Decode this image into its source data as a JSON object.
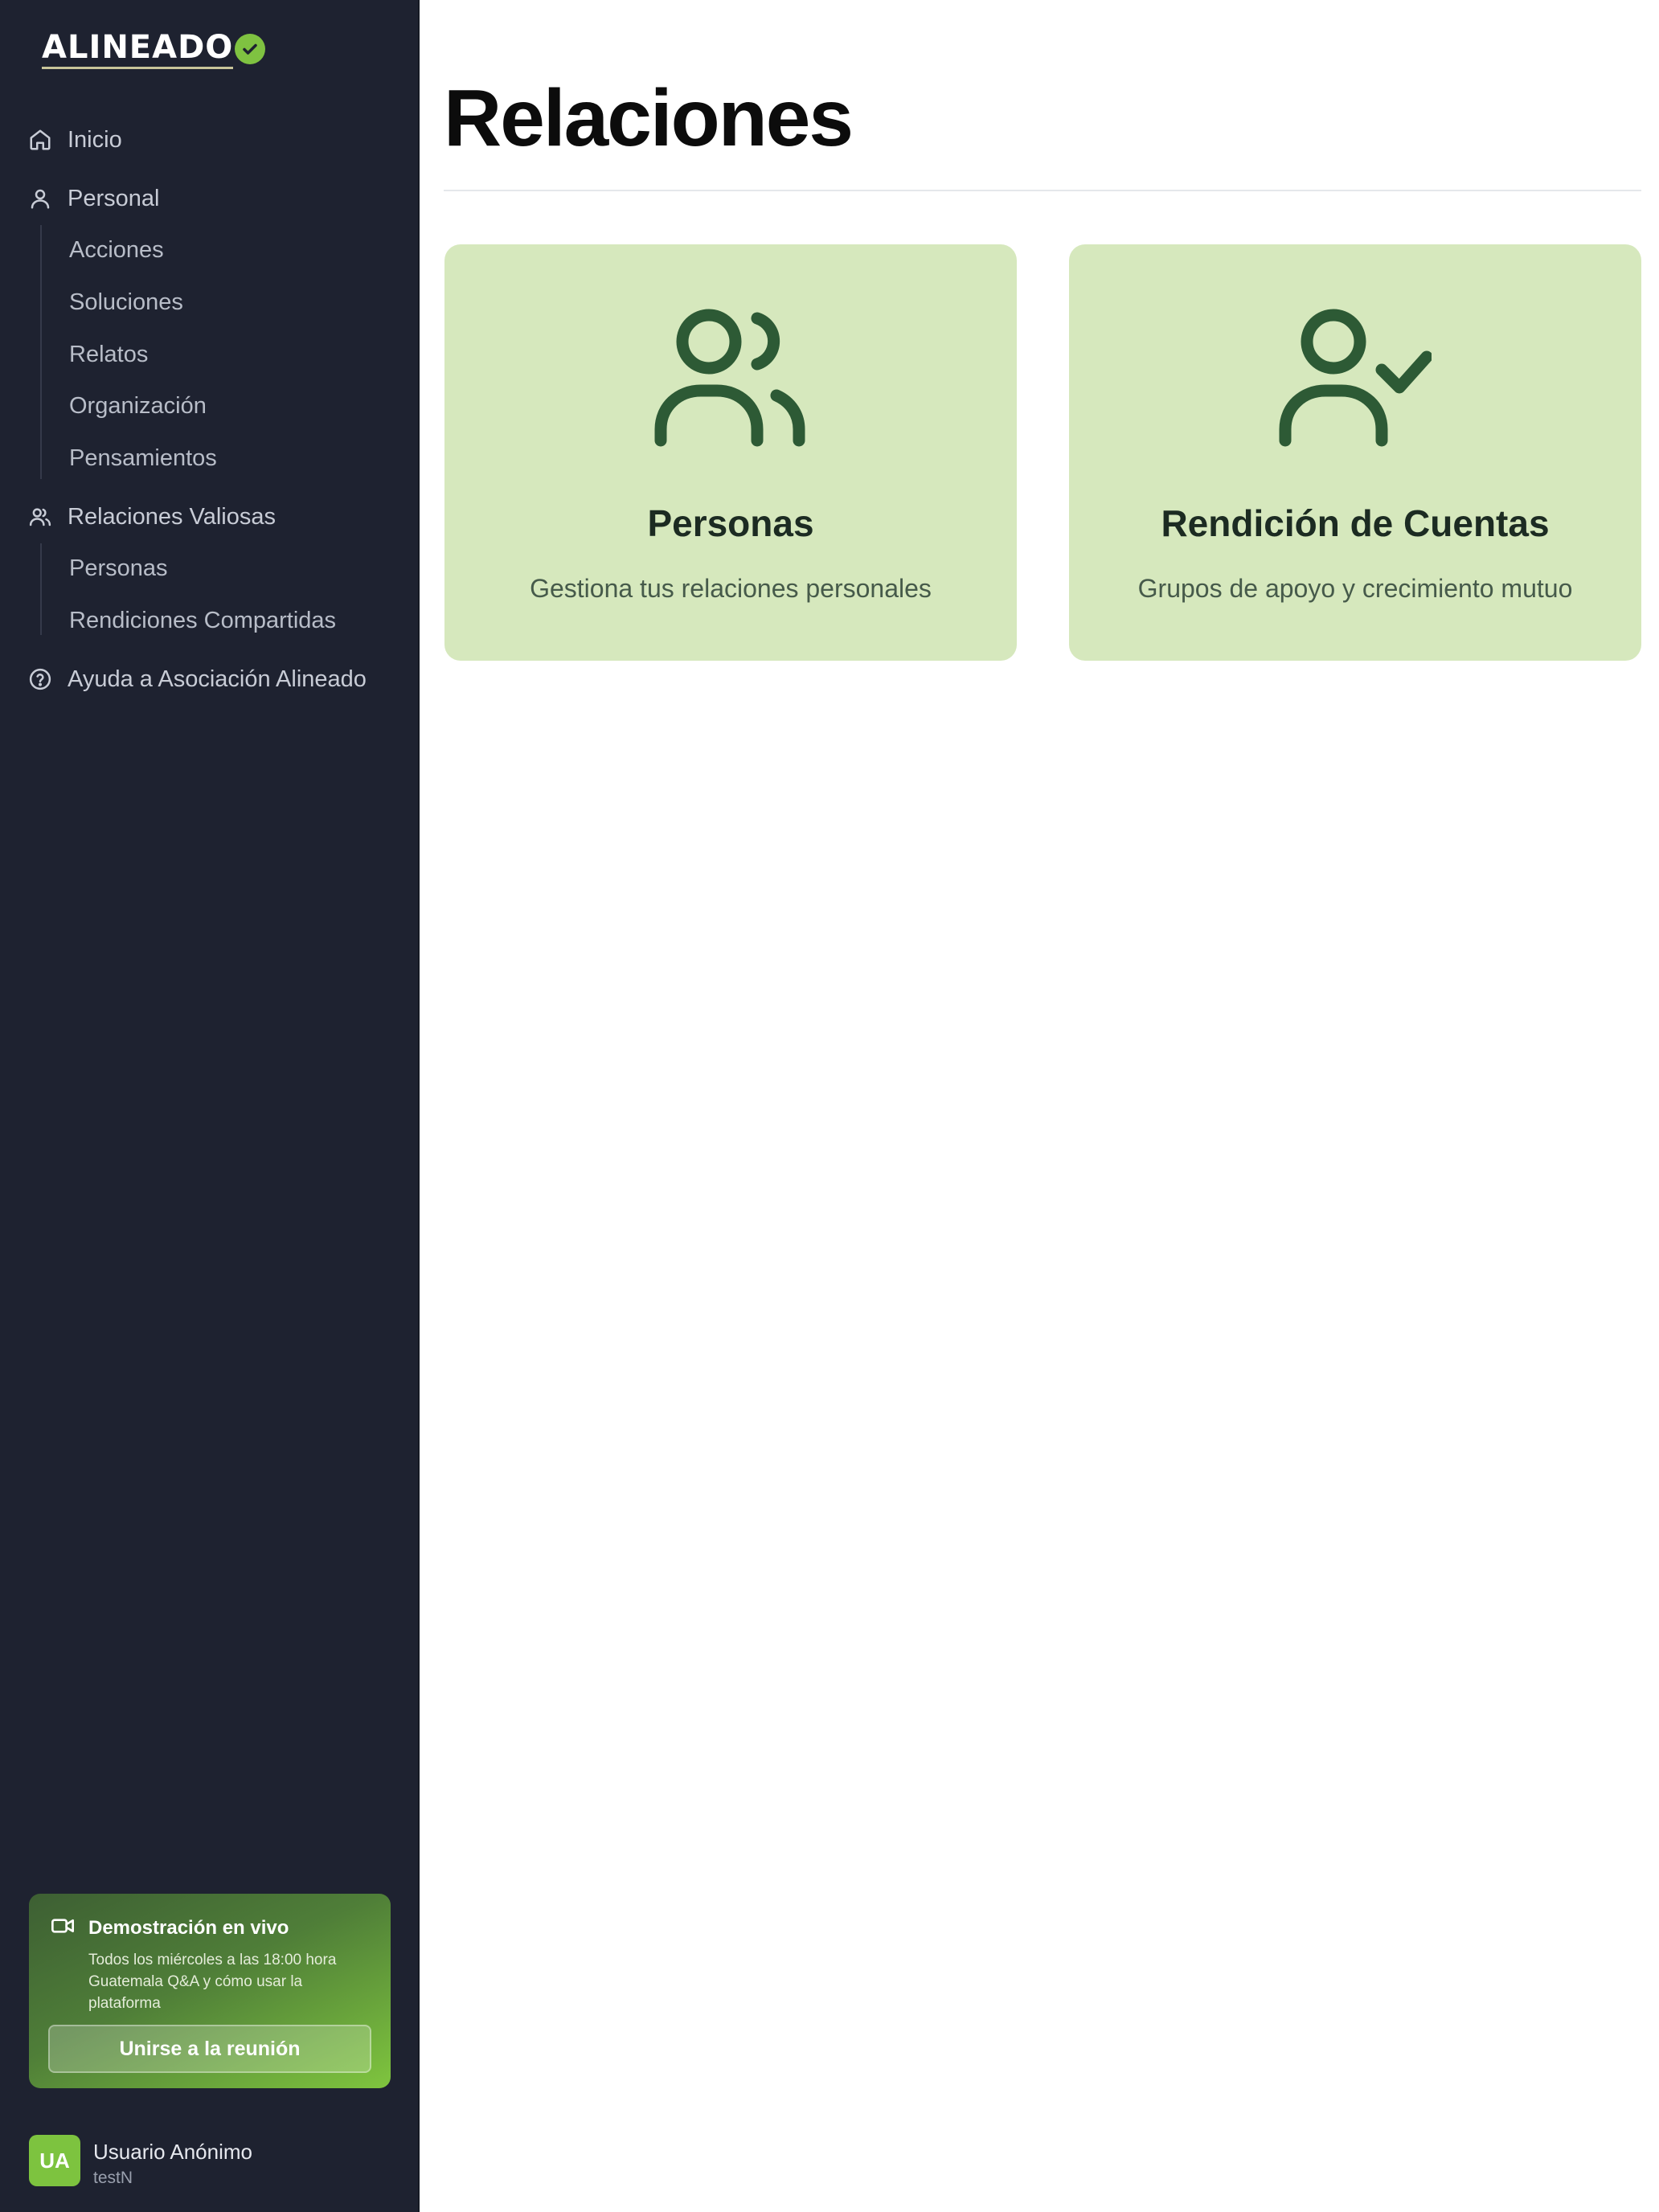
{
  "brand": {
    "logo_text": "ALINEADO",
    "logo_icon": "check-circle-icon",
    "accent": "#7fc241"
  },
  "sidebar": {
    "items": [
      {
        "label": "Inicio",
        "icon": "home-icon"
      },
      {
        "label": "Personal",
        "icon": "user-icon",
        "children": [
          "Acciones",
          "Soluciones",
          "Relatos",
          "Organización",
          "Pensamientos"
        ]
      },
      {
        "label": "Relaciones Valiosas",
        "icon": "users-icon",
        "children": [
          "Personas",
          "Rendiciones Compartidas"
        ]
      },
      {
        "label": "Ayuda a Asociación Alineado",
        "icon": "help-circle-icon"
      }
    ]
  },
  "demo": {
    "title": "Demostración en vivo",
    "text": "Todos los miércoles a las 18:00 hora Guatemala Q&A y cómo usar la plataforma",
    "button": "Unirse a la reunión",
    "icon": "video-icon"
  },
  "user": {
    "initials": "UA",
    "name": "Usuario Anónimo",
    "sub": "testN"
  },
  "main": {
    "title": "Relaciones",
    "cards": [
      {
        "title": "Personas",
        "desc": "Gestiona tus relaciones personales",
        "icon": "users-icon"
      },
      {
        "title": "Rendición de Cuentas",
        "desc": "Grupos de apoyo y crecimiento mutuo",
        "icon": "user-check-icon"
      }
    ],
    "card_bg": "#d6e8bd",
    "icon_color": "#2d5a35"
  }
}
